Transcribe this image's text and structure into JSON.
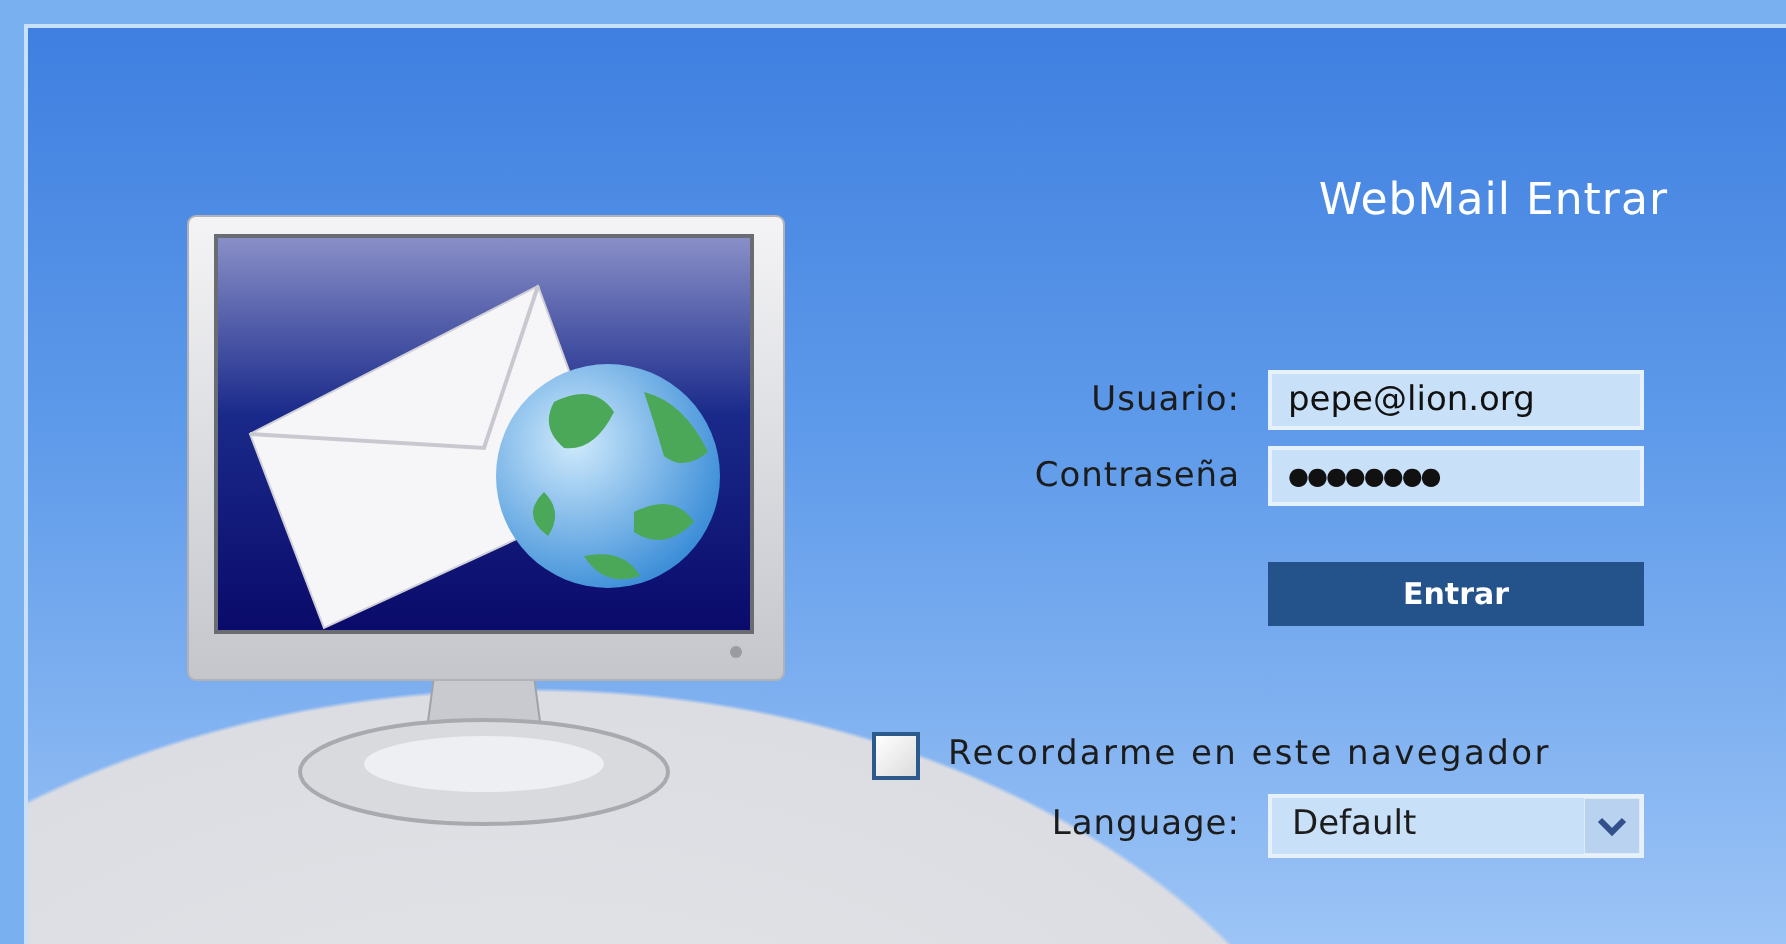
{
  "title": "WebMail Entrar",
  "fields": [
    {
      "label": "Usuario:",
      "value": "pepe@lion.org",
      "kind": "text"
    },
    {
      "label": "Contraseña",
      "value": "●●●●●●●●",
      "kind": "password"
    }
  ],
  "submit_button": "Entrar",
  "remember": {
    "label": "Recordarme en este navegador",
    "checked": false
  },
  "language": {
    "label": "Language:",
    "value": "Default"
  }
}
